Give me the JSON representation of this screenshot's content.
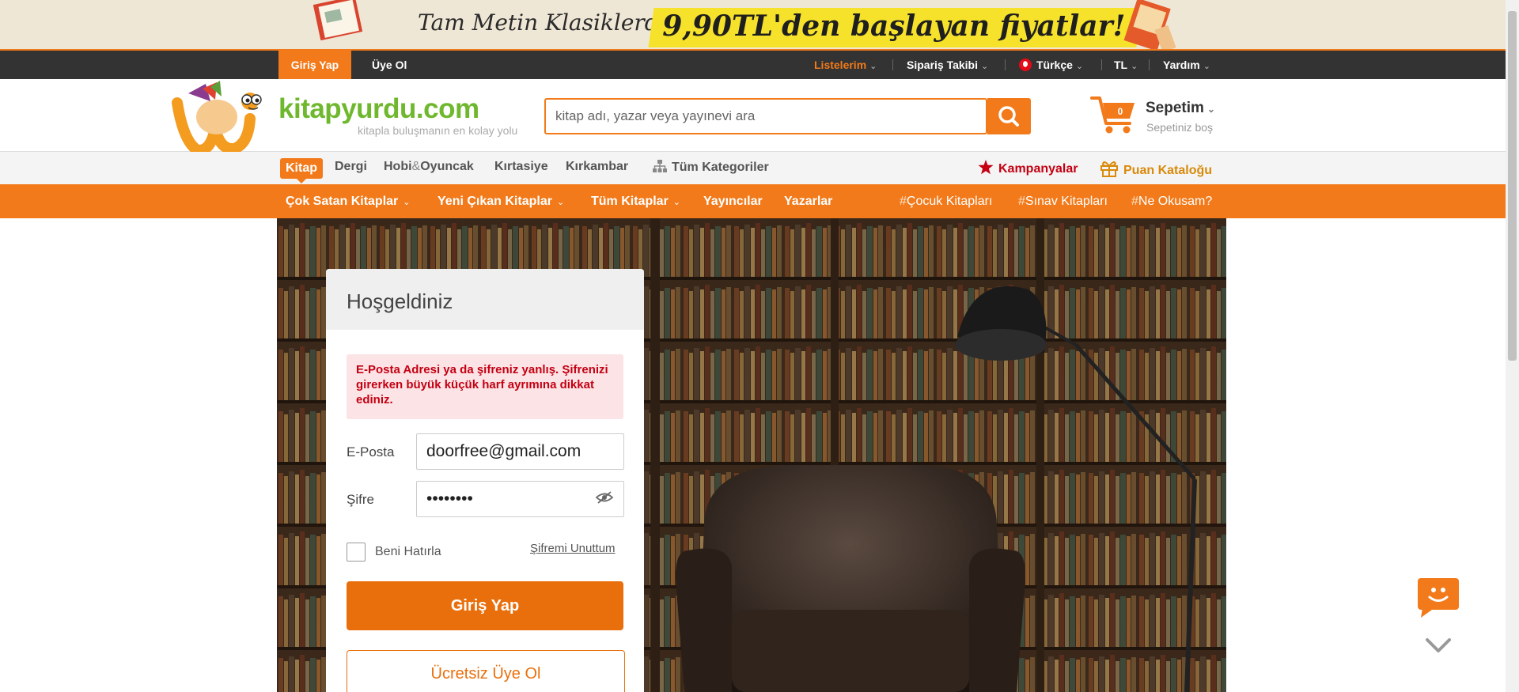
{
  "promo": {
    "lead": "Tam Metin Klasiklerde",
    "highlight": "9,90TL'den başlayan fiyatlar!"
  },
  "topbar": {
    "login": "Giriş Yap",
    "signup": "Üye Ol",
    "lists": "Listelerim",
    "order_tracking": "Sipariş Takibi",
    "language": "Türkçe",
    "currency": "TL",
    "help": "Yardım"
  },
  "header": {
    "logo": "kitapyurdu.com",
    "tagline": "kitapla buluşmanın en kolay yolu",
    "search_placeholder": "kitap adı, yazar veya yayınevi ara",
    "cart_count": "0",
    "cart_title": "Sepetim",
    "cart_status": "Sepetiniz boş"
  },
  "categories": {
    "active": "Kitap",
    "items": [
      "Dergi",
      "Hobi",
      "&",
      "Oyuncak",
      "Kırtasiye",
      "Kırkambar"
    ],
    "all": "Tüm Kategoriler",
    "campaigns": "Kampanyalar",
    "points": "Puan Kataloğu"
  },
  "nav": {
    "bestsellers": "Çok Satan Kitaplar",
    "new_releases": "Yeni Çıkan Kitaplar",
    "all_books": "Tüm Kitaplar",
    "publishers": "Yayıncılar",
    "authors": "Yazarlar",
    "tags": [
      "Çocuk Kitapları",
      "Sınav Kitapları",
      "Ne Okusam?"
    ]
  },
  "login": {
    "title": "Hoşgeldiniz",
    "error": "E-Posta Adresi ya da şifreniz yanlış. Şifrenizi girerken büyük küçük harf ayrımına dikkat ediniz.",
    "email_label": "E-Posta",
    "email_value": "doorfree@gmail.com",
    "password_label": "Şifre",
    "password_value": "password",
    "remember": "Beni Hatırla",
    "forgot": "Şifremi Unuttum",
    "submit": "Giriş Yap",
    "register": "Ücretsiz Üye Ol"
  },
  "colors": {
    "brand_orange": "#f27a1a",
    "logo_green": "#6fb82e",
    "error_red": "#c40012"
  }
}
